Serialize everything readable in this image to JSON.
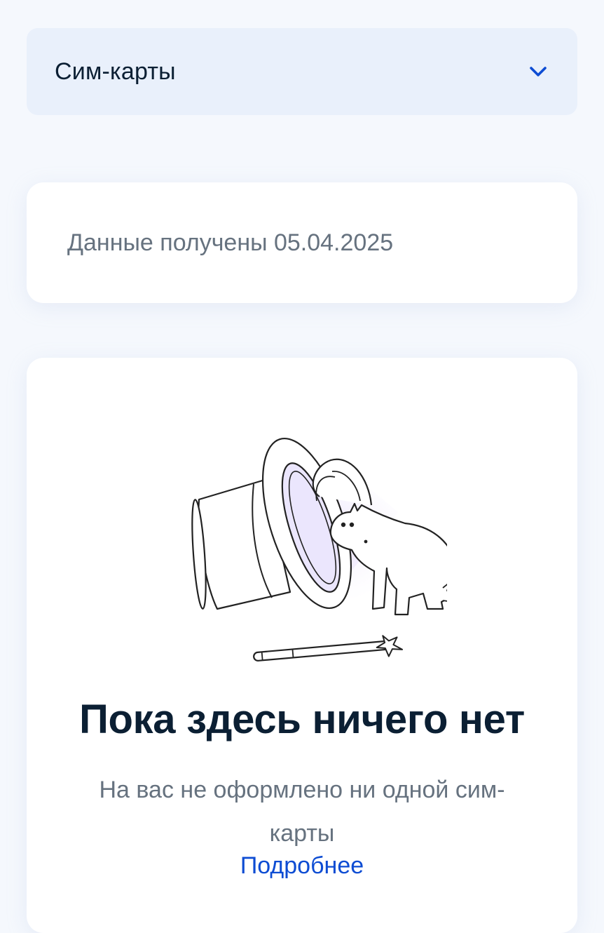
{
  "dropdown": {
    "label": "Сим-карты",
    "icon": "chevron-down-icon"
  },
  "info": {
    "text": "Данные получены 05.04.2025"
  },
  "empty_state": {
    "illustration": "magic-hat-rabbit-illustration",
    "title": "Пока здесь ничего нет",
    "description": "На вас не оформлено ни одной сим-карты",
    "link_label": "Подробнее"
  },
  "colors": {
    "background": "#f5f8fd",
    "dropdown_bg": "#e9f0fb",
    "card_bg": "#ffffff",
    "title": "#0b1f33",
    "secondary_text": "#66727f",
    "link": "#0d4cd3",
    "accent_icon": "#0d4cd3"
  }
}
